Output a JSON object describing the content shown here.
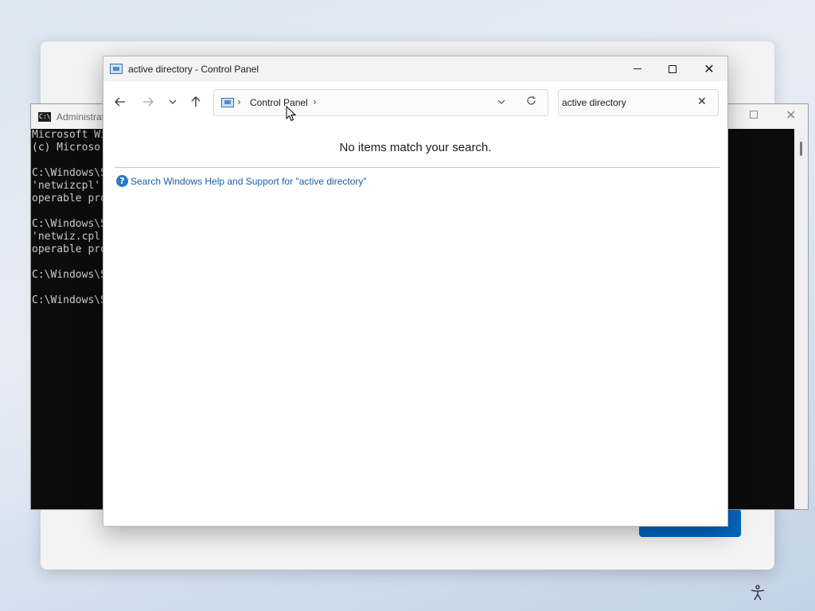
{
  "console": {
    "title": "Administrat",
    "icon_text": "C:\\",
    "lines": [
      "Microsoft Wi",
      "(c) Microso",
      "",
      "C:\\Windows\\S",
      "'netwizcpl'",
      "operable pro",
      "",
      "C:\\Windows\\S",
      "'netwiz.cpl",
      "operable pro",
      "",
      "C:\\Windows\\S",
      "",
      "C:\\Windows\\S"
    ]
  },
  "control_panel": {
    "title": "active directory - Control Panel",
    "address": {
      "crumb": "Control Panel"
    },
    "search": {
      "value": "active directory"
    },
    "message": "No items match your search.",
    "help_link": "Search Windows Help and Support for \"active directory\""
  },
  "icons": {
    "back": "back-arrow-icon",
    "forward": "forward-arrow-icon",
    "recent": "chevron-down-icon",
    "up": "up-arrow-icon",
    "refresh": "refresh-icon",
    "clear": "close-icon",
    "help": "help-icon",
    "accessibility": "accessibility-icon"
  },
  "colors": {
    "accent": "#0067c0",
    "link": "#1a5fa8",
    "console_bg": "#0c0c0c"
  }
}
